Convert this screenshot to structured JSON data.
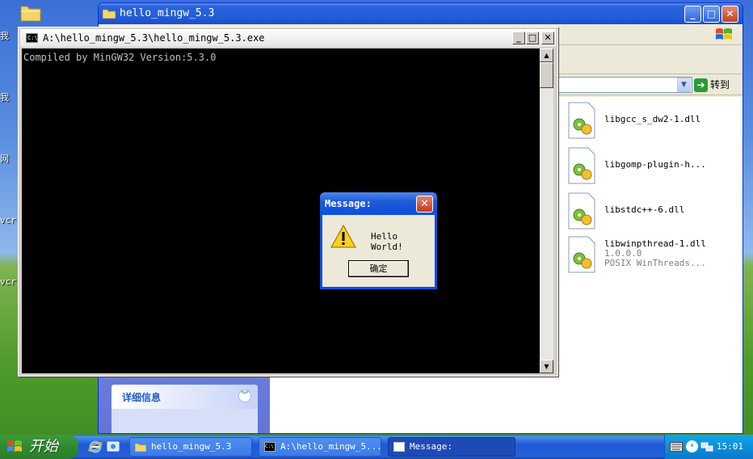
{
  "desktop": {
    "icon_labels": [
      "我",
      "我",
      "网",
      "vcr",
      "vcr"
    ]
  },
  "explorer": {
    "title": "hello_mingw_5.3",
    "go_label": "转到",
    "details_label": "详细信息",
    "files": [
      {
        "name": "libgcc_s_dw2-1.dll",
        "lines": []
      },
      {
        "name": "libgomp-plugin-h...",
        "lines": []
      },
      {
        "name": "libstdc++-6.dll",
        "lines": []
      },
      {
        "name": "libwinpthread-1.dll",
        "lines": [
          "1.0.0.0",
          "POSIX WinThreads..."
        ]
      }
    ]
  },
  "console": {
    "title": "A:\\hello_mingw_5.3\\hello_mingw_5.3.exe",
    "icon_text": "C:\\",
    "output": "Compiled by MinGW32 Version:5.3.0"
  },
  "message_box": {
    "title": "Message:",
    "text": "Hello World!",
    "ok_label": "确定"
  },
  "taskbar": {
    "start_label": "开始",
    "buttons": [
      {
        "label": "hello_mingw_5.3"
      },
      {
        "label": "A:\\hello_mingw_5..."
      },
      {
        "label": "Message:"
      }
    ],
    "clock": "15:01"
  },
  "colors": {
    "titlebar_blue": "#245edb",
    "console_bg": "#000000",
    "console_text": "#c0c0c0",
    "taskbar_blue": "#2560d8",
    "start_green": "#2f8a2f"
  }
}
